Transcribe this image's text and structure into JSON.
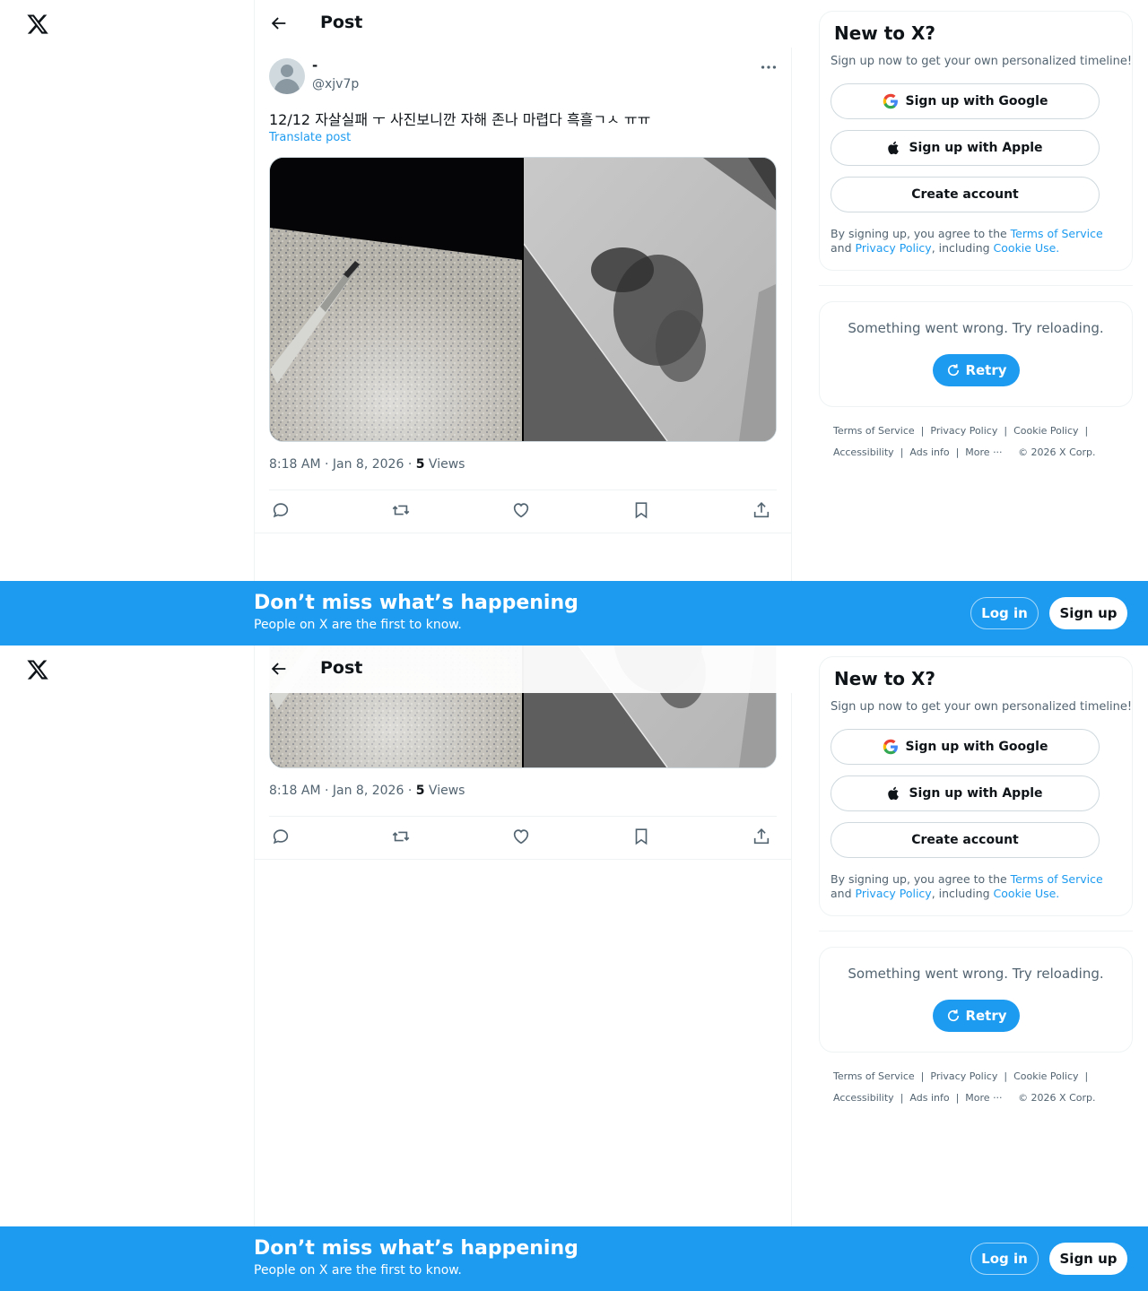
{
  "header": {
    "title": "Post"
  },
  "post": {
    "display_name": "-",
    "handle": "@xjv7p",
    "text": "12/12 자살실패 ㅜ 사진보니깐 자해 존나 마렵다 흑흘ㄱㅅ ㅠㅠ",
    "translate_label": "Translate post",
    "time": "8:18 AM · Jan 8, 2026 · ",
    "views_count": "5",
    "views_label": " Views"
  },
  "icons": {
    "logo": "x-logo-icon",
    "back": "arrow-left-icon",
    "more": "more-horizontal-icon",
    "reply": "reply-icon",
    "repost": "repost-icon",
    "like": "heart-icon",
    "bookmark": "bookmark-icon",
    "share": "share-icon",
    "google": "google-icon",
    "apple": "apple-icon",
    "retry": "refresh-icon"
  },
  "signup": {
    "title": "New to X?",
    "subtitle": "Sign up now to get your own personalized timeline!",
    "google_label": "Sign up with Google",
    "apple_label": "Sign up with Apple",
    "create_label": "Create account",
    "terms_prefix": "By signing up, you agree to the ",
    "terms_link": "Terms of Service",
    "terms_and": " and ",
    "privacy_link": "Privacy Policy",
    "terms_mid": ", including ",
    "cookie_link": "Cookie Use."
  },
  "error": {
    "message": "Something went wrong. Try reloading.",
    "retry_label": "Retry"
  },
  "footer": {
    "terms": "Terms of Service",
    "privacy": "Privacy Policy",
    "cookie": "Cookie Policy",
    "accessibility": "Accessibility",
    "ads": "Ads info",
    "more": "More ···",
    "copyright": "© 2026 X Corp.",
    "separator": "|"
  },
  "banner": {
    "title": "Don’t miss what’s happening",
    "subtitle": "People on X are the first to know.",
    "login_label": "Log in",
    "signup_label": "Sign up"
  },
  "colors": {
    "accent": "#1d9bf0",
    "text": "#0f1419",
    "muted": "#536471",
    "border": "#eff3f4"
  }
}
